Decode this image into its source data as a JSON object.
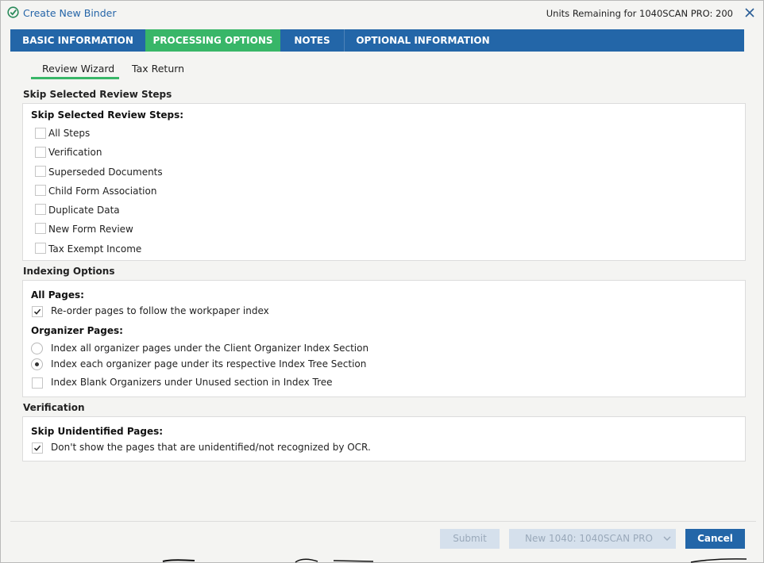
{
  "titlebar": {
    "title": "Create New Binder",
    "units": "Units Remaining for 1040SCAN PRO: 200"
  },
  "tabs": [
    {
      "label": "BASIC INFORMATION"
    },
    {
      "label": "PROCESSING OPTIONS",
      "active": true
    },
    {
      "label": "NOTES"
    },
    {
      "label": "OPTIONAL INFORMATION"
    }
  ],
  "subtabs": [
    {
      "label": "Review Wizard",
      "active": true
    },
    {
      "label": "Tax Return"
    }
  ],
  "skip_review": {
    "section_title": "Skip Selected Review Steps",
    "panel_label": "Skip Selected Review Steps:",
    "items": [
      {
        "label": "All Steps",
        "checked": false
      },
      {
        "label": "Verification",
        "checked": false
      },
      {
        "label": "Superseded Documents",
        "checked": false
      },
      {
        "label": "Child Form Association",
        "checked": false
      },
      {
        "label": "Duplicate Data",
        "checked": false
      },
      {
        "label": "New Form Review",
        "checked": false
      },
      {
        "label": "Tax Exempt Income",
        "checked": false
      }
    ]
  },
  "indexing": {
    "section_title": "Indexing Options",
    "all_pages_label": "All Pages:",
    "reorder_label": "Re-order pages to follow the workpaper index",
    "reorder_checked": true,
    "organizer_label": "Organizer Pages:",
    "radio_options": [
      {
        "label": "Index all organizer pages under the Client Organizer Index Section",
        "selected": false
      },
      {
        "label": "Index each organizer page under its respective Index Tree Section",
        "selected": true
      }
    ],
    "blank_label": "Index Blank Organizers under Unused section in Index Tree",
    "blank_checked": false
  },
  "verification": {
    "section_title": "Verification",
    "panel_label": "Skip Unidentified Pages:",
    "option_label": "Don't show the pages that are unidentified/not recognized by OCR.",
    "option_checked": true
  },
  "footer": {
    "submit_label": "Submit",
    "dropdown_value": "New 1040: 1040SCAN PRO",
    "cancel_label": "Cancel"
  },
  "colors": {
    "tab_bar": "#2366a8",
    "tab_active": "#38b668",
    "title_text": "#2565a8"
  },
  "icons": {
    "title": "binder-check-icon",
    "close": "close-icon",
    "checkbox_mark": "checkmark-icon",
    "dropdown": "chevron-down-icon"
  }
}
